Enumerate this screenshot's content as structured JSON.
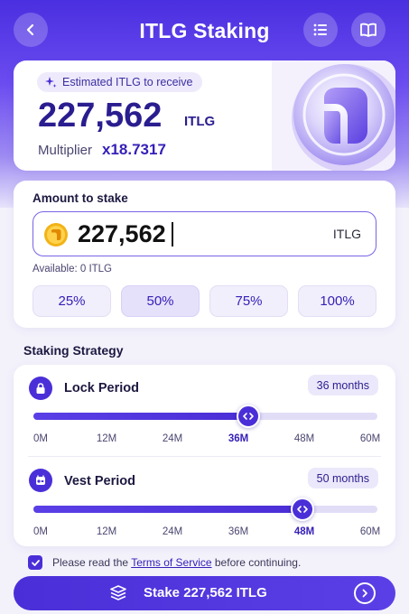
{
  "header": {
    "title": "ITLG Staking",
    "back_icon": "chevron-left-icon",
    "list_icon": "list-icon",
    "book_icon": "book-icon"
  },
  "estimate": {
    "badge": "Estimated ITLG to receive",
    "amount": "227,562",
    "unit": "ITLG",
    "multiplier_label": "Multiplier",
    "multiplier_value": "x18.7317"
  },
  "stake": {
    "label": "Amount to stake",
    "value": "227,562",
    "unit": "ITLG",
    "available": "Available: 0 ITLG",
    "percent_options": [
      "25%",
      "50%",
      "75%",
      "100%"
    ],
    "selected_percent": "50%"
  },
  "strategy": {
    "title": "Staking Strategy",
    "lock": {
      "label": "Lock Period",
      "value": "36 months",
      "ticks": [
        "0M",
        "12M",
        "24M",
        "36M",
        "48M",
        "60M"
      ],
      "selected_tick": "36M",
      "fraction": 0.625
    },
    "vest": {
      "label": "Vest Period",
      "value": "50 months",
      "ticks": [
        "0M",
        "12M",
        "24M",
        "36M",
        "48M",
        "60M"
      ],
      "selected_tick": "48M",
      "fraction": 0.781
    }
  },
  "terms": {
    "before": "Please read the ",
    "link": "Terms of Service",
    "after": " before continuing.",
    "checked": true
  },
  "cta": {
    "label": "Stake 227,562 ITLG"
  },
  "colors": {
    "accent": "#4a2fd8",
    "accent_text": "#3520b8",
    "background": "#f3f2fb"
  }
}
